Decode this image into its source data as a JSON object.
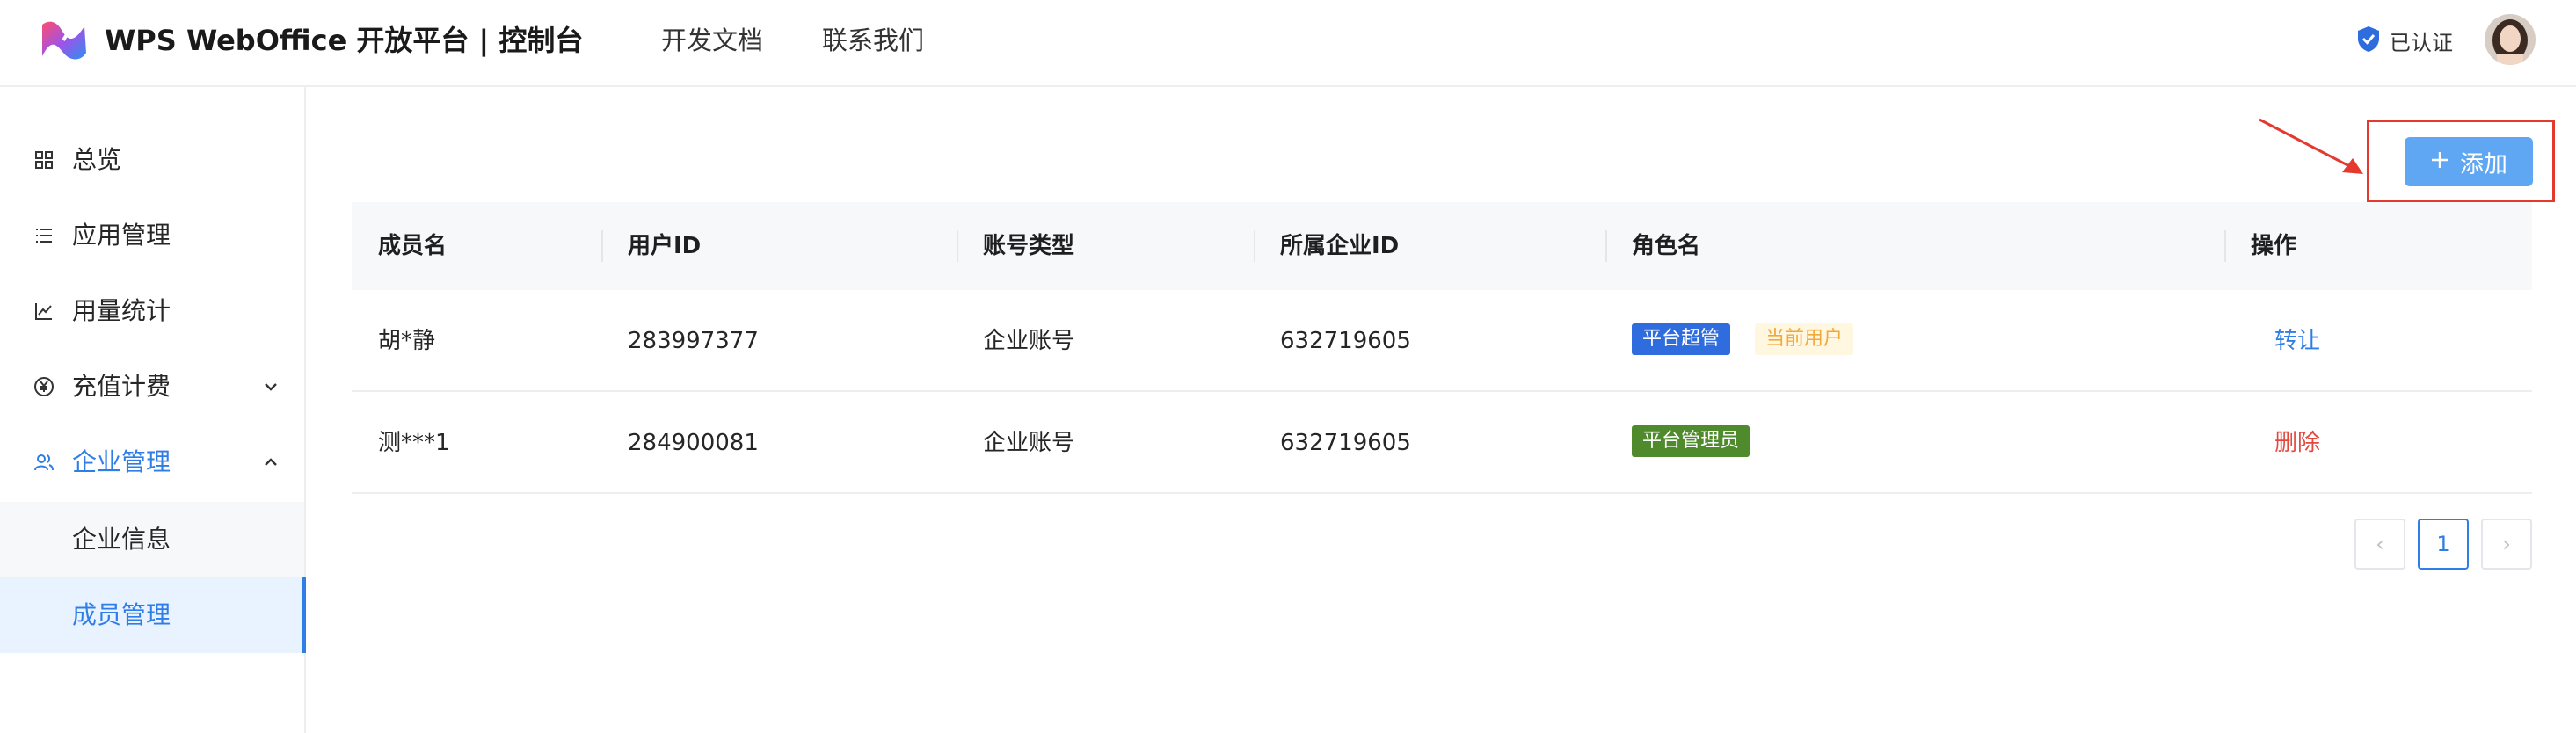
{
  "header": {
    "brand": "WPS WebOffice 开放平台 | 控制台",
    "nav": [
      "开发文档",
      "联系我们"
    ],
    "verified_label": "已认证"
  },
  "sidebar": {
    "items": [
      {
        "label": "总览",
        "icon": "grid-icon"
      },
      {
        "label": "应用管理",
        "icon": "list-icon"
      },
      {
        "label": "用量统计",
        "icon": "line-chart-icon"
      },
      {
        "label": "充值计费",
        "icon": "yen-icon"
      },
      {
        "label": "企业管理",
        "icon": "users-icon"
      }
    ],
    "sub_items": [
      {
        "label": "企业信息"
      },
      {
        "label": "成员管理"
      }
    ]
  },
  "toolbar": {
    "add_label": "添加"
  },
  "table": {
    "columns": [
      "成员名",
      "用户ID",
      "账号类型",
      "所属企业ID",
      "角色名",
      "操作"
    ],
    "rows": [
      {
        "name": "胡*静",
        "user_id": "283997377",
        "account_type": "企业账号",
        "company_id": "632719605",
        "role": "平台超管",
        "extra_tag": "当前用户",
        "action": "转让"
      },
      {
        "name": "测***1",
        "user_id": "284900081",
        "account_type": "企业账号",
        "company_id": "632719605",
        "role": "平台管理员",
        "extra_tag": "",
        "action": "删除"
      }
    ]
  },
  "pagination": {
    "current_page": "1",
    "prev_symbol": "‹",
    "next_symbol": "›"
  },
  "colors": {
    "accent": "#2f7ee8",
    "highlight": "#e4392f",
    "danger": "#e4483c"
  }
}
